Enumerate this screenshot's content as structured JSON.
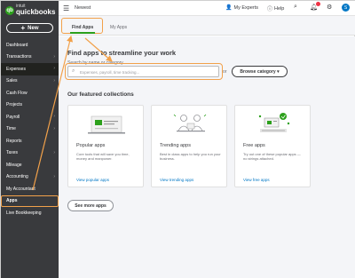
{
  "sidebar": {
    "logo_brand": "intuit",
    "logo_product": "quickbooks",
    "new_button": "New",
    "items": [
      {
        "label": "Dashboard",
        "chevron": false
      },
      {
        "label": "Transactions",
        "chevron": true
      },
      {
        "label": "Expenses",
        "chevron": true
      },
      {
        "label": "Sales",
        "chevron": true
      },
      {
        "label": "Cash Flow",
        "chevron": false
      },
      {
        "label": "Projects",
        "chevron": false
      },
      {
        "label": "Payroll",
        "chevron": true
      },
      {
        "label": "Time",
        "chevron": true
      },
      {
        "label": "Reports",
        "chevron": false
      },
      {
        "label": "Taxes",
        "chevron": true
      },
      {
        "label": "Mileage",
        "chevron": false
      },
      {
        "label": "Accounting",
        "chevron": true
      },
      {
        "label": "My Accountant",
        "chevron": false
      },
      {
        "label": "Apps",
        "chevron": false
      },
      {
        "label": "Live Bookkeeping",
        "chevron": false
      }
    ]
  },
  "topbar": {
    "company": "Newest",
    "my_experts": "My Experts",
    "help": "Help",
    "avatar_initial": "S"
  },
  "tabs": {
    "find_apps": "Find Apps",
    "my_apps": "My Apps"
  },
  "main": {
    "heading": "Find apps to streamline your work",
    "search_label": "Search by name or category",
    "search_placeholder": "Expenses, payroll, time tracking...",
    "or": "or",
    "browse_category": "Browse category ▾",
    "featured_heading": "Our featured collections",
    "cards": [
      {
        "title": "Popular apps",
        "desc": "Core tools that will save you time, money and manpower.",
        "link": "View popular apps"
      },
      {
        "title": "Trending apps",
        "desc": "Best in class apps to help you run your business.",
        "link": "View trending apps"
      },
      {
        "title": "Free apps",
        "desc": "Try out one of these popular apps — no strings attached.",
        "link": "View free apps"
      }
    ],
    "see_more": "See more apps"
  },
  "colors": {
    "sidebar": "#393a3d",
    "brand_green": "#2ca01c",
    "link_blue": "#0077c5",
    "highlight_orange": "#f2a14a"
  }
}
